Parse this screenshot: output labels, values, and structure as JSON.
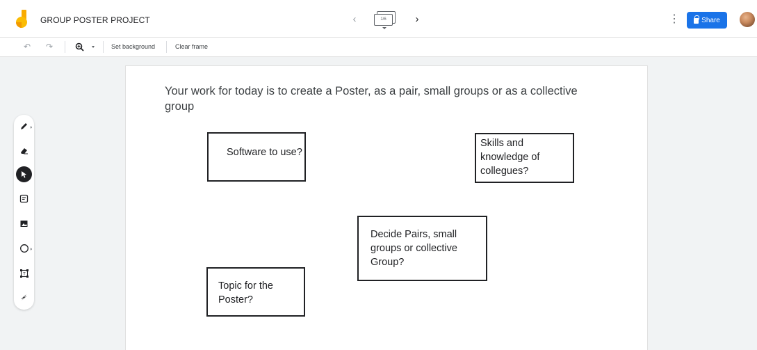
{
  "app": {
    "title": "GROUP POSTER PROJECT",
    "logo_icon": "jamboard-logo-icon",
    "brand_color": "#f9ab00"
  },
  "frame_nav": {
    "prev_icon": "‹",
    "next_icon": "›",
    "indicator": "1/6",
    "thumbnail_icon": "frame-bar-icon"
  },
  "header_actions": {
    "more_icon": "⋮",
    "share_label": "Share",
    "share_color": "#1a73e8",
    "avatar_icon": "user-avatar"
  },
  "toolbar": {
    "undo_icon": "↶",
    "redo_icon": "↷",
    "zoom_icon": "zoom-in-icon",
    "set_background_label": "Set background",
    "clear_frame_label": "Clear frame"
  },
  "side_tools": [
    {
      "name": "pen-tool",
      "icon": "pen-icon",
      "active": false
    },
    {
      "name": "eraser-tool",
      "icon": "eraser-icon",
      "active": false
    },
    {
      "name": "select-tool",
      "icon": "cursor-arrow-icon",
      "active": true
    },
    {
      "name": "sticky-note-tool",
      "icon": "sticky-note-icon",
      "active": false
    },
    {
      "name": "image-tool",
      "icon": "image-icon",
      "active": false
    },
    {
      "name": "shape-tool",
      "icon": "circle-icon",
      "active": false
    },
    {
      "name": "text-box-tool",
      "icon": "text-box-icon",
      "active": false
    },
    {
      "name": "laser-tool",
      "icon": "laser-pointer-icon",
      "active": false
    }
  ],
  "canvas": {
    "prompt": "Your work for today is to create a Poster, as a pair, small groups or as a collective group",
    "notes": [
      {
        "id": "software",
        "text": "Software to use?"
      },
      {
        "id": "skills",
        "text": "Skills and knowledge of collegues?"
      },
      {
        "id": "decide",
        "text": "Decide Pairs, small groups or collective Group?"
      },
      {
        "id": "topic",
        "text": "Topic for the Poster?"
      }
    ]
  }
}
